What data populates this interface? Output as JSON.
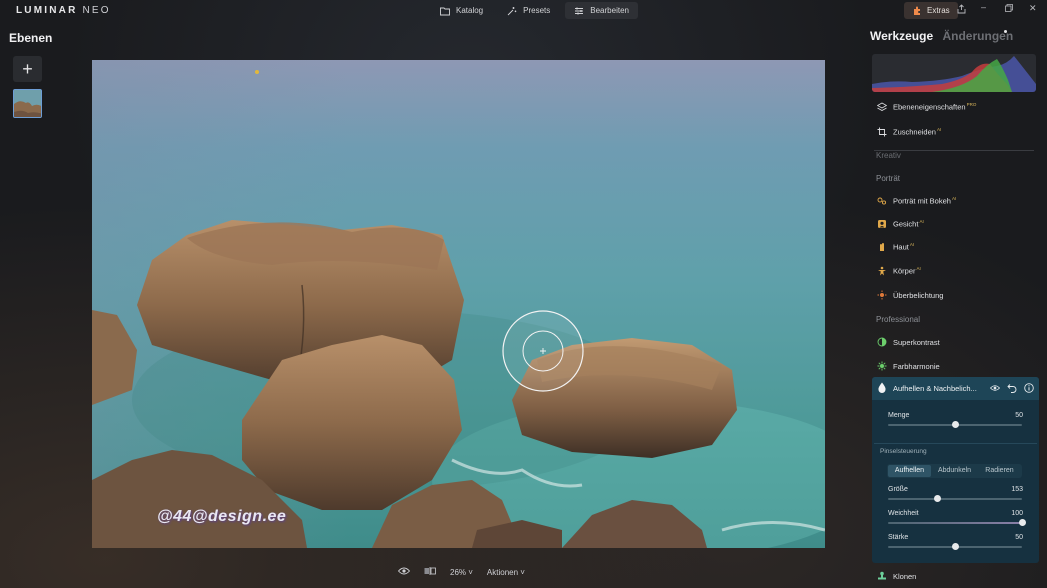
{
  "app": {
    "logo_main": "LUMINAR",
    "logo_sub": "NEO"
  },
  "nav": {
    "items": [
      {
        "label": "Katalog",
        "icon": "folder-icon",
        "active": false
      },
      {
        "label": "Presets",
        "icon": "sparkle-icon",
        "active": false
      },
      {
        "label": "Bearbeiten",
        "icon": "sliders-icon",
        "active": true
      }
    ],
    "extras_label": "Extras"
  },
  "left_panel": {
    "title": "Ebenen",
    "add_label": "+"
  },
  "canvas": {
    "watermark": "@44@design.ee"
  },
  "bottom_bar": {
    "zoom": "26%",
    "actions_label": "Aktionen"
  },
  "right_panel": {
    "tab_tools": "Werkzeuge",
    "tab_changes": "Änderungen",
    "top_tools": [
      {
        "label": "Ebeneneigenschaften",
        "badge": "PRO"
      },
      {
        "label": "Zuschneiden",
        "badge": "AI"
      }
    ],
    "section_kreativ": "Kreativ",
    "section_portrait": "Porträt",
    "portrait_tools": [
      {
        "label": "Porträt mit Bokeh",
        "badge": "AI"
      },
      {
        "label": "Gesicht",
        "badge": "AI"
      },
      {
        "label": "Haut",
        "badge": "AI"
      },
      {
        "label": "Körper",
        "badge": "AI"
      },
      {
        "label": "Überbelichtung",
        "badge": ""
      }
    ],
    "section_professional": "Professional",
    "pro_tools": [
      {
        "label": "Superkontrast"
      },
      {
        "label": "Farbharmonie"
      }
    ],
    "active_tool": {
      "label": "Aufhellen & Nachbelich...",
      "menge_label": "Menge",
      "menge_value": "50",
      "menge_fraction": 0.5,
      "brush_section": "Pinselsteuerung",
      "modes": [
        "Aufhellen",
        "Abdunkeln",
        "Radieren"
      ],
      "active_mode": "Aufhellen",
      "groesse_label": "Größe",
      "groesse_value": "153",
      "groesse_fraction": 0.37,
      "weichheit_label": "Weichheit",
      "weichheit_value": "100",
      "weichheit_fraction": 1.0,
      "staerke_label": "Stärke",
      "staerke_value": "50",
      "staerke_fraction": 0.5
    },
    "bottom_tool": {
      "label": "Klonen"
    }
  }
}
